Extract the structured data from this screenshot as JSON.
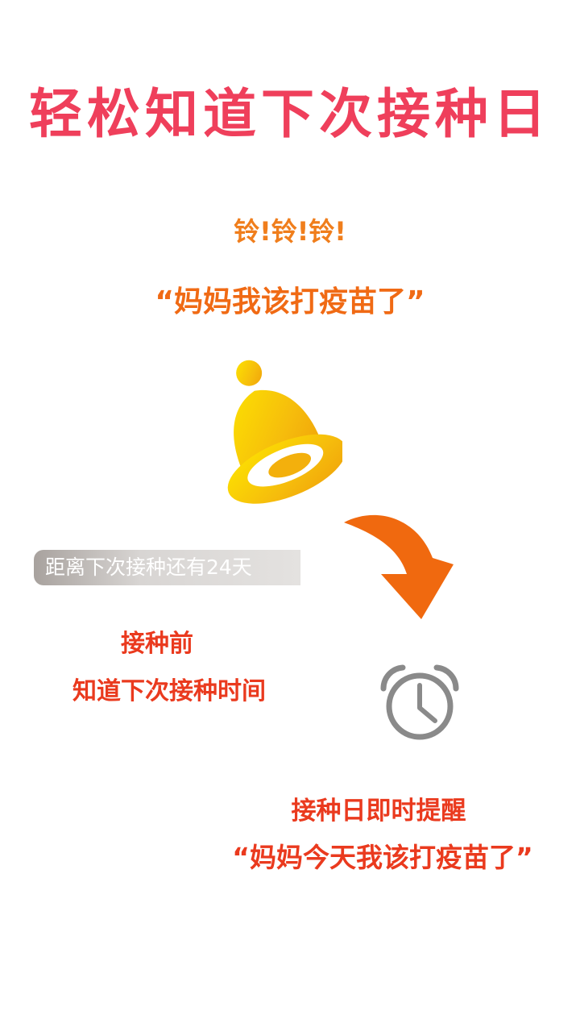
{
  "title": "轻松知道下次接种日",
  "ring_text": "铃!铃!铃!",
  "child_quote": "“妈妈我该打疫苗了”",
  "countdown_text": "距离下次接种还有24天",
  "before": {
    "line1": "接种前",
    "line2": "知道下次接种时间"
  },
  "reminder": {
    "line1": "接种日即时提醒",
    "line2": "“妈妈今天我该打疫苗了”"
  },
  "icons": {
    "bell": "bell-icon",
    "arrow": "curved-arrow-icon",
    "clock": "alarm-clock-icon"
  },
  "colors": {
    "title": "#ef3f5b",
    "orange": "#f06a14",
    "red": "#ea3a1e",
    "bell": "#f5b80e",
    "clock": "#8a8a8a"
  }
}
